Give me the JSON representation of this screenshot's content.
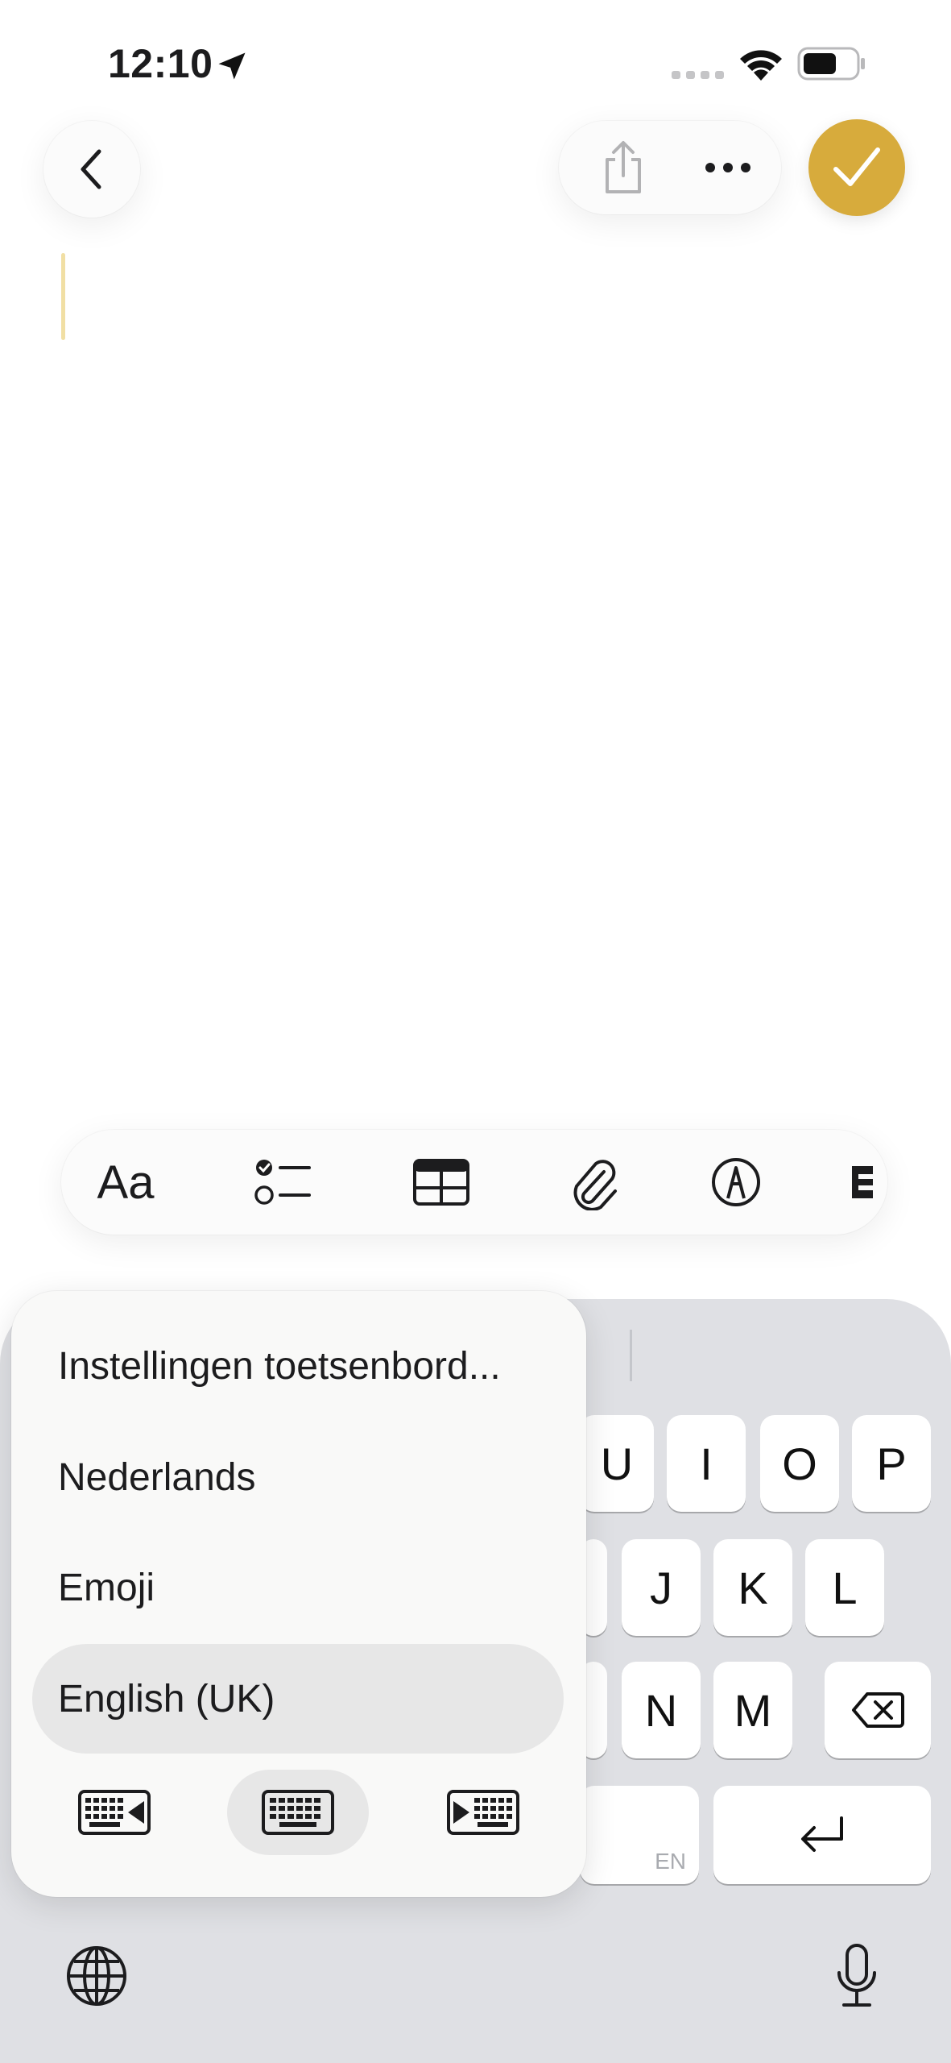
{
  "status_bar": {
    "time": "12:10"
  },
  "keyboard": {
    "row1": [
      "U",
      "I",
      "O",
      "P"
    ],
    "row2": [
      "J",
      "K",
      "L"
    ],
    "row3": [
      "N",
      "M"
    ],
    "space_hint": "EN"
  },
  "language_menu": {
    "items": [
      {
        "label": "Instellingen toetsenbord..."
      },
      {
        "label": "Nederlands"
      },
      {
        "label": "Emoji"
      },
      {
        "label": "English (UK)",
        "selected": true
      }
    ],
    "keyboard_modes": [
      "left-handed",
      "full",
      "right-handed"
    ],
    "selected_mode": "full"
  },
  "colors": {
    "accent": "#d7ab3c",
    "keyboard_bg": "#dfe0e4",
    "popup_bg": "#f9f9f8",
    "selection": "#e7e7e7"
  },
  "toolbar": {
    "format_label": "Aa"
  }
}
